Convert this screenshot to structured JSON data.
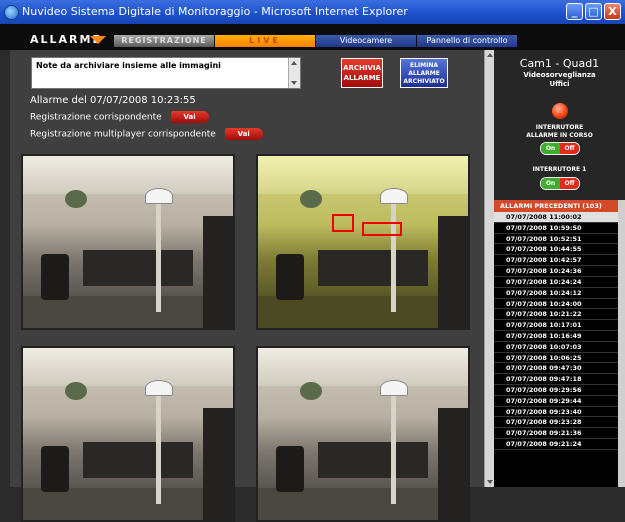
{
  "window": {
    "title": "Nuvideo Sistema Digitale di Monitoraggio - Microsoft Internet Explorer",
    "controls": [
      "_",
      "□",
      "X"
    ]
  },
  "nav": {
    "brand": "ALLARME",
    "tabs": [
      {
        "label": "REGISTRAZIONE"
      },
      {
        "label": "LIVE"
      },
      {
        "label": "Videocamere"
      },
      {
        "label": "Pannello di controllo"
      }
    ]
  },
  "notes": {
    "placeholder": "Note da archiviare insieme alle immagini"
  },
  "buttons": {
    "archivia": "ARCHIVIA ALLARME",
    "elimina": "ELIMINA ALLARME ARCHIVIATO"
  },
  "alarm": {
    "date_label": "Allarme del 07/07/2008 10:23:55",
    "reg_label": "Registrazione corrispondente",
    "multi_label": "Registrazione multiplayer corrispondente",
    "vai": "Vai"
  },
  "camera": {
    "title": "Cam1 - Quad1",
    "subtitle1": "Videosorveglianza",
    "subtitle2": "Uffici"
  },
  "switches": [
    {
      "label1": "INTERRUTORE",
      "label2": "ALLARME IN CORSO",
      "on": "On",
      "off": "Off"
    },
    {
      "label1": "INTERRUTORE 1",
      "label2": "",
      "on": "On",
      "off": "Off"
    }
  ],
  "history": {
    "header": "ALLARMI PRECEDENTI (103)",
    "items": [
      "07/07/2008 11:00:02",
      "07/07/2008 10:59:50",
      "07/07/2008 10:52:51",
      "07/07/2008 10:44:55",
      "07/07/2008 10:42:57",
      "07/07/2008 10:24:36",
      "07/07/2008 10:24:24",
      "07/07/2008 10:24:12",
      "07/07/2008 10:24:00",
      "07/07/2008 10:21:22",
      "07/07/2008 10:17:01",
      "07/07/2008 10:16:49",
      "07/07/2008 10:07:03",
      "07/07/2008 10:06:25",
      "07/07/2008 09:47:30",
      "07/07/2008 09:47:18",
      "07/07/2008 09:29:56",
      "07/07/2008 09:29:44",
      "07/07/2008 09:23:40",
      "07/07/2008 09:23:28",
      "07/07/2008 09:21:36",
      "07/07/2008 09:21:24"
    ]
  }
}
